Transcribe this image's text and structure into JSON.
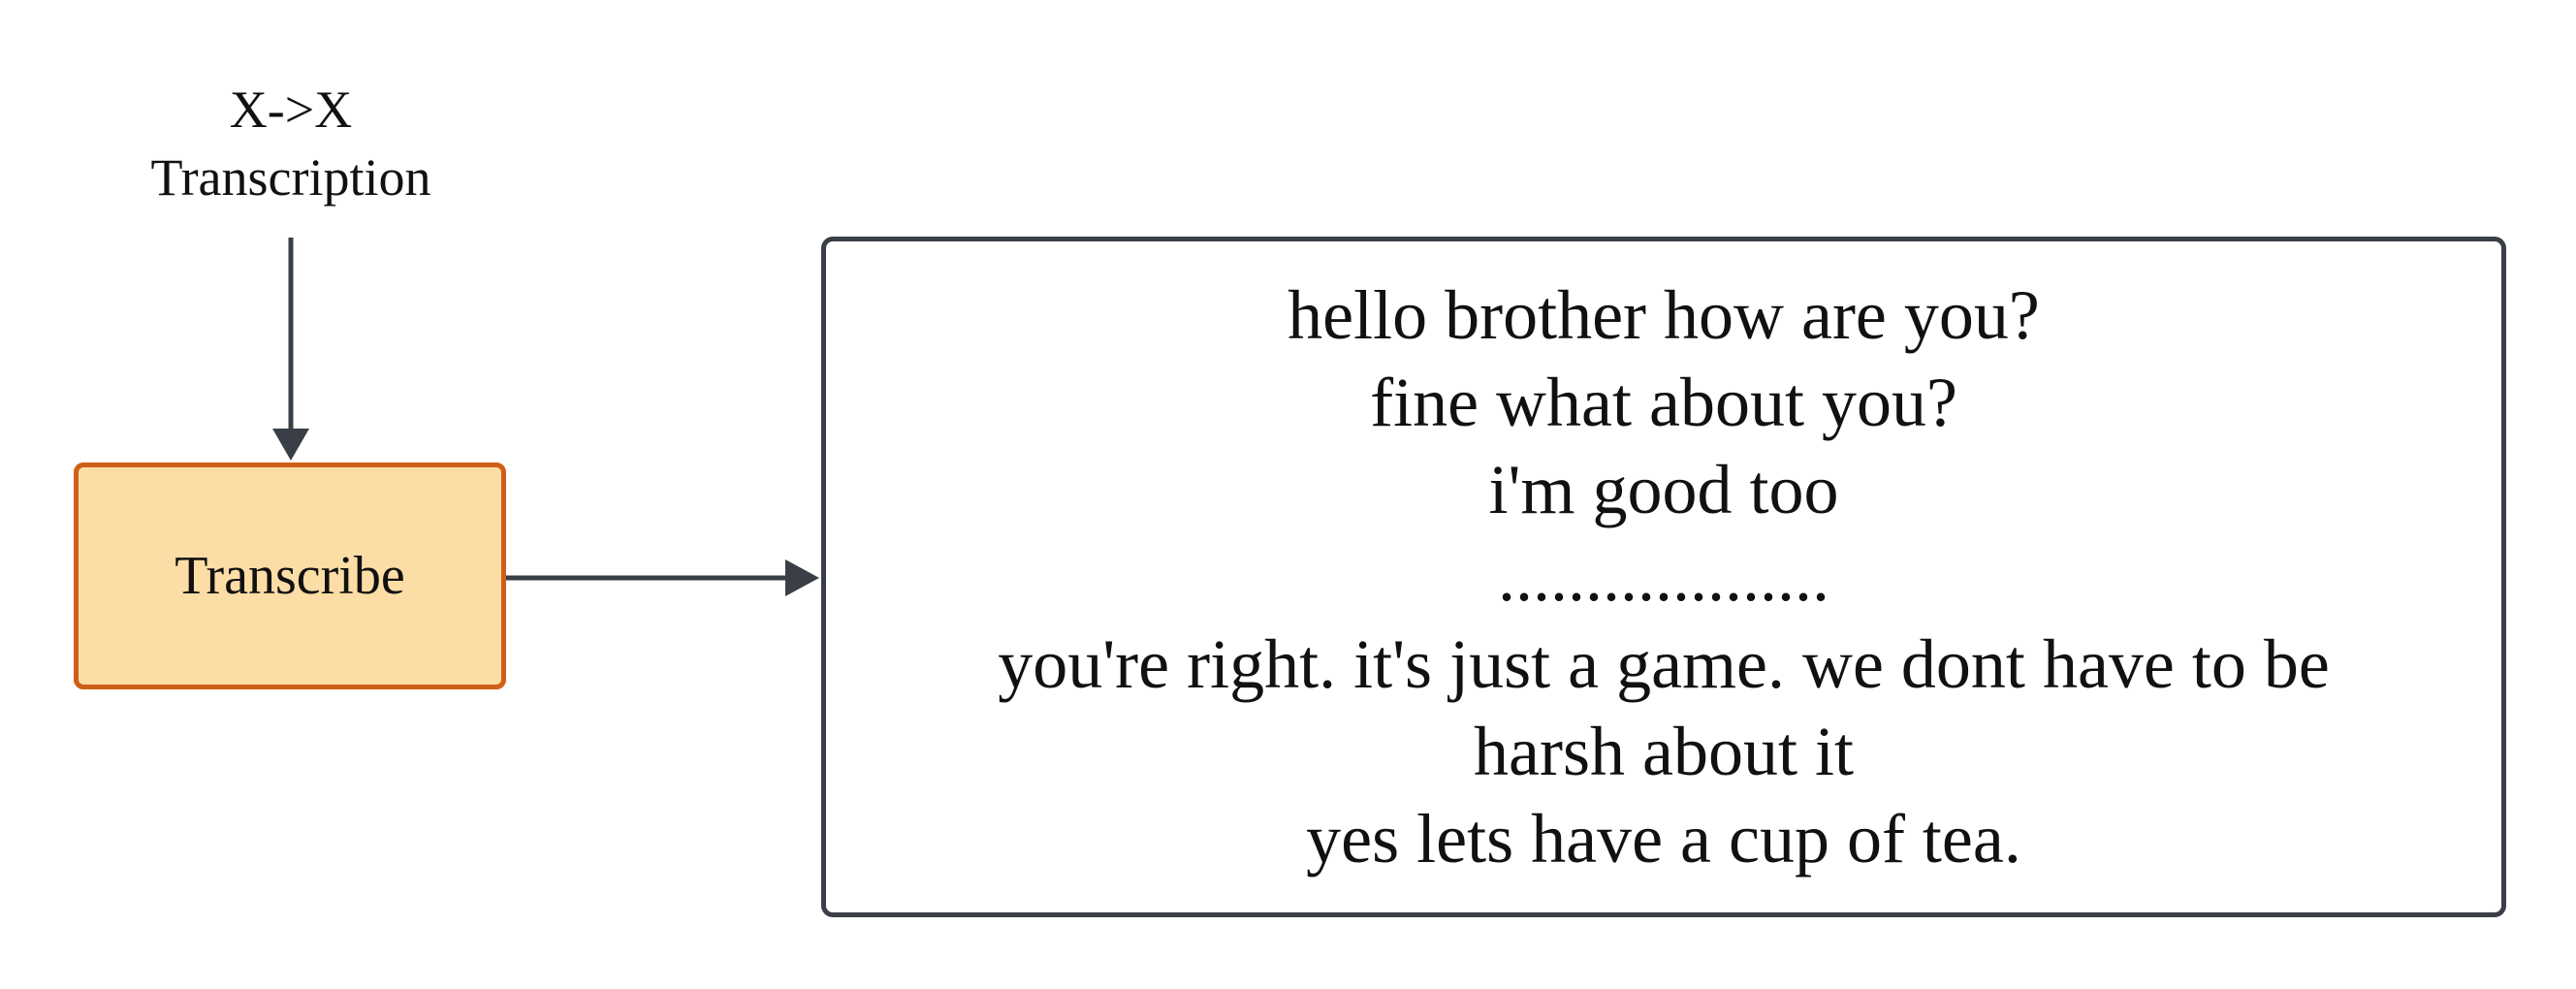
{
  "input_label": {
    "line1": "X->X",
    "line2": "Transcription"
  },
  "process": {
    "label": "Transcribe"
  },
  "output": {
    "lines": [
      "hello brother how are you?",
      "fine what about you?",
      "i'm good too",
      "...................",
      "you're right. it's just a game. we dont have to be",
      "harsh about it",
      "yes lets have a cup of tea."
    ]
  },
  "colors": {
    "process_fill": "#fddda6",
    "process_border": "#cf5f16",
    "line_color": "#3a3e47"
  }
}
